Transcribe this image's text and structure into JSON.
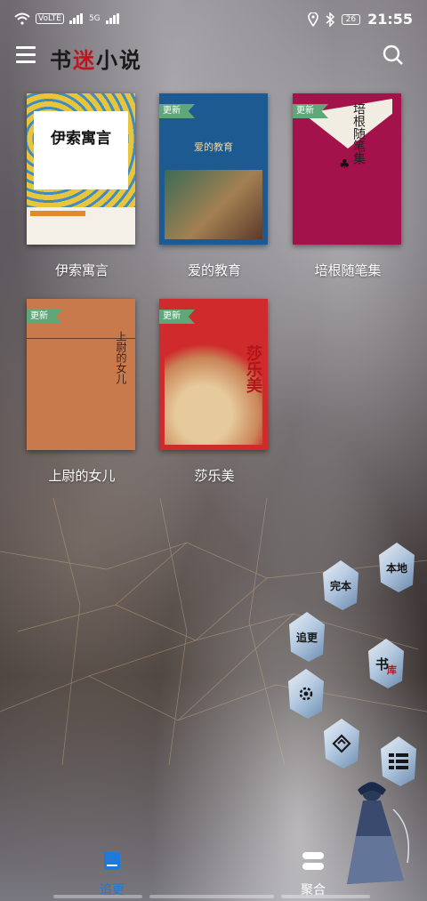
{
  "status": {
    "volte": "VoLTE",
    "net_5g": "5G",
    "battery": "26",
    "time": "21:55"
  },
  "header": {
    "logo_left": "书",
    "logo_red": "迷",
    "logo_right": "小说"
  },
  "books": [
    {
      "title": "伊索寓言",
      "cover_text": "伊索寓言",
      "badge": ""
    },
    {
      "title": "爱的教育",
      "cover_text": "爱的教育",
      "badge": "更新"
    },
    {
      "title": "培根随笔集",
      "cover_text": "培根随笔集",
      "badge": "更新"
    },
    {
      "title": "上尉的女儿",
      "cover_text": "上尉的女儿",
      "badge": "更新"
    },
    {
      "title": "莎乐美",
      "cover_text": "莎乐美",
      "badge": "更新"
    }
  ],
  "float_buttons": {
    "wanben": "完本",
    "bendi": "本地",
    "zhuigeng": "追更",
    "shuku_a": "书",
    "shuku_b": "库"
  },
  "nav": {
    "tab1": "追更",
    "tab2": "聚合"
  },
  "colors": {
    "accent": "#1e7ad6",
    "badge": "#5fa779",
    "logo_red": "#c0141e"
  }
}
